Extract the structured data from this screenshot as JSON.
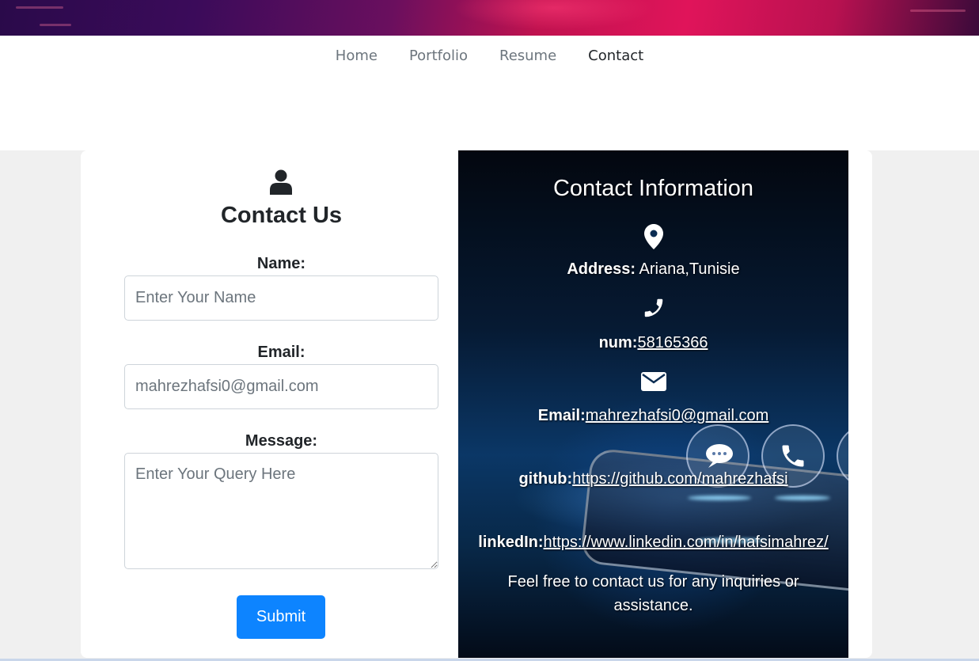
{
  "nav": {
    "items": [
      {
        "label": "Home"
      },
      {
        "label": "Portfolio"
      },
      {
        "label": "Resume"
      },
      {
        "label": "Contact"
      }
    ],
    "active": "Contact"
  },
  "form": {
    "icon": "user-icon",
    "title": "Contact Us",
    "name_label": "Name:",
    "name_placeholder": "Enter Your Name",
    "email_label": "Email:",
    "email_value": "mahrezhafsi0@gmail.com",
    "message_label": "Message:",
    "message_placeholder": "Enter Your Query Here",
    "submit_label": "Submit"
  },
  "info": {
    "title": "Contact Information",
    "address_label": "Address:",
    "address_value": "Ariana,Tunisie",
    "phone_label": "num:",
    "phone_value": "58165366",
    "email_label": "Email:",
    "email_value": "mahrezhafsi0@gmail.com",
    "github_label": "github:",
    "github_value": "https://github.com/mahrezhafsi",
    "linkedin_label": "linkedIn:",
    "linkedin_value": "https://www.linkedin.com/in/hafsimahrez/",
    "closing_text": "Feel free to contact us for any inquiries or assistance."
  },
  "colors": {
    "accent": "#0d84ff",
    "banner": "#e0145a",
    "info_bg": "#061a33"
  }
}
